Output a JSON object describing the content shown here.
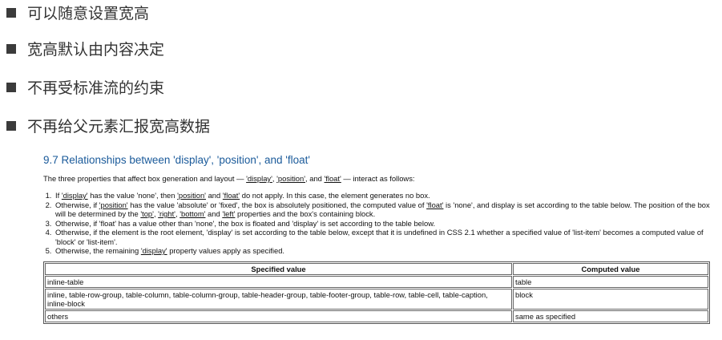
{
  "bullets": [
    "可以随意设置宽高",
    "宽高默认由内容决定",
    "不再受标准流的约束",
    "不再给父元素汇报宽高数据"
  ],
  "spec": {
    "heading": "9.7 Relationships between 'display', 'position', and 'float'",
    "intro": {
      "a": "The three properties that affect box generation and layout — ",
      "display": "'display'",
      "sep1": ", ",
      "position": "'position'",
      "sep2": ", and ",
      "float": "'float'",
      "b": " — interact as follows:"
    },
    "rules": [
      {
        "a": "If ",
        "l1": "'display'",
        "b": " has the value 'none', then ",
        "l2": "'position'",
        "c": " and ",
        "l3": "'float'",
        "d": " do not apply. In this case, the element generates no box."
      },
      {
        "a": "Otherwise, if ",
        "l1": "'position'",
        "b": " has the value 'absolute' or 'fixed', the box is absolutely positioned, the computed value of ",
        "l2": "'float'",
        "c": " is 'none', and display is set according to the table below. The position of the box will be determined by the ",
        "l3": "'top'",
        "d": ", ",
        "l4": "'right'",
        "e": ", ",
        "l5": "'bottom'",
        "f": " and ",
        "l6": "'left'",
        "g": " properties and the box's containing block."
      },
      {
        "text": "Otherwise, if 'float' has a value other than 'none', the box is floated and 'display' is set according to the table below."
      },
      {
        "text": "Otherwise, if the element is the root element, 'display' is set according to the table below, except that it is undefined in CSS 2.1 whether a specified value of 'list-item' becomes a computed value of 'block' or 'list-item'."
      },
      {
        "a": "Otherwise, the remaining ",
        "l1": "'display'",
        "b": " property values apply as specified."
      }
    ],
    "table": {
      "headers": [
        "Specified value",
        "Computed value"
      ],
      "rows": [
        [
          "inline-table",
          "table"
        ],
        [
          "inline, table-row-group, table-column, table-column-group, table-header-group, table-footer-group, table-row, table-cell, table-caption, inline-block",
          "block"
        ],
        [
          "others",
          "same as specified"
        ]
      ]
    }
  }
}
